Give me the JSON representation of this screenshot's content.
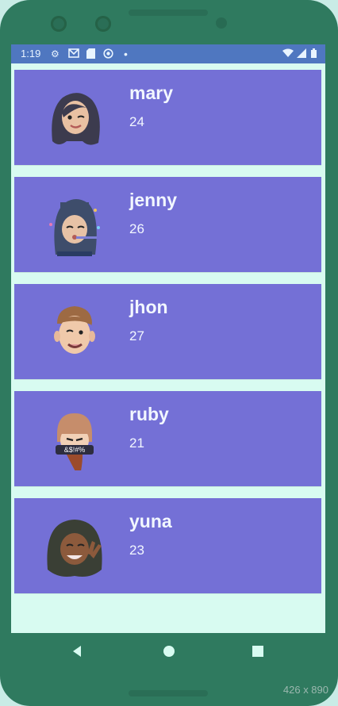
{
  "status": {
    "time": "1:19",
    "icons_left": [
      "gear-icon",
      "gmail-icon",
      "sdcard-icon",
      "target-icon",
      "dot-icon"
    ],
    "icons_right": [
      "wifi-icon",
      "signal-icon",
      "battery-icon"
    ]
  },
  "people": [
    {
      "name": "mary",
      "age": "24",
      "avatar": "avatar-mary"
    },
    {
      "name": "jenny",
      "age": "26",
      "avatar": "avatar-jenny"
    },
    {
      "name": "jhon",
      "age": "27",
      "avatar": "avatar-jhon"
    },
    {
      "name": "ruby",
      "age": "21",
      "avatar": "avatar-ruby",
      "avatar_text": "&$!#%"
    },
    {
      "name": "yuna",
      "age": "23",
      "avatar": "avatar-yuna"
    }
  ],
  "watermark": "426 x 890",
  "colors": {
    "card": "#7470d6",
    "statusbar": "#4f77c0",
    "screen": "#d8fbf1",
    "phone": "#2f7a5f"
  }
}
